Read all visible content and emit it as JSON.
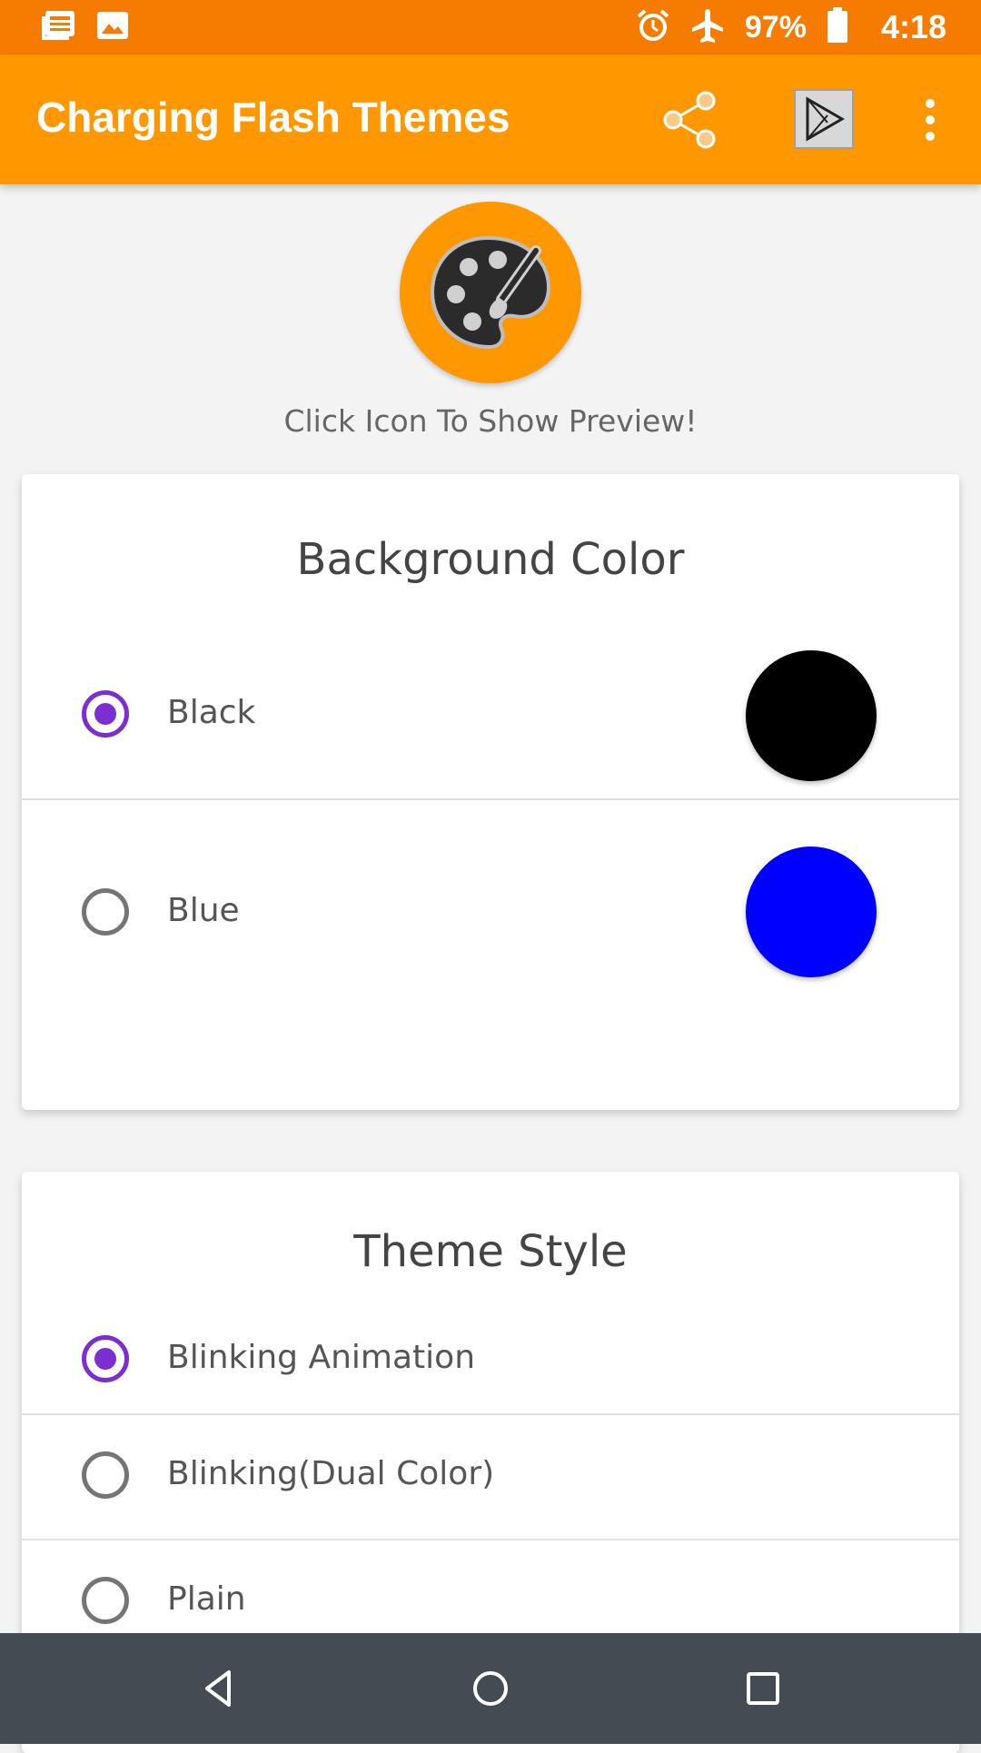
{
  "status_bar": {
    "battery": "97%",
    "time": "4:18",
    "icons": [
      "news-icon",
      "image-icon",
      "alarm-icon",
      "airplane-icon",
      "battery-icon"
    ]
  },
  "app_bar": {
    "title": "Charging Flash Themes",
    "actions": [
      "share-icon",
      "play-store-icon",
      "more-vert-icon"
    ]
  },
  "preview": {
    "icon": "palette-icon",
    "caption": "Click Icon To Show Preview!"
  },
  "background_color": {
    "title": "Background Color",
    "options": [
      {
        "label": "Black",
        "checked": true,
        "color": "#000000"
      },
      {
        "label": "Blue",
        "checked": false,
        "color": "#0000ff"
      }
    ]
  },
  "theme_style": {
    "title": "Theme Style",
    "options": [
      {
        "label": "Blinking Animation",
        "checked": true
      },
      {
        "label": "Blinking(Dual Color)",
        "checked": false
      },
      {
        "label": "Plain",
        "checked": false
      }
    ]
  },
  "colors": {
    "accent": "#ff9800",
    "status": "#f57c00",
    "radio_checked": "#7b2fd0",
    "nav_bar": "#444b53"
  },
  "nav_bar": [
    "back-icon",
    "home-icon",
    "recents-icon"
  ]
}
